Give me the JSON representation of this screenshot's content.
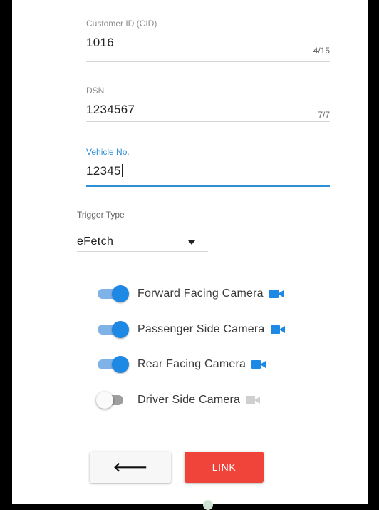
{
  "form": {
    "customer_id": {
      "label": "Customer ID (CID)",
      "value": "1016",
      "counter": "4/15"
    },
    "dsn": {
      "label": "DSN",
      "value": "1234567",
      "counter": "7/7"
    },
    "vehicle_no": {
      "label": "Vehicle No.",
      "value": "12345"
    },
    "trigger_type": {
      "label": "Trigger Type",
      "value": "eFetch"
    }
  },
  "cameras": [
    {
      "label": "Forward Facing Camera",
      "enabled": true
    },
    {
      "label": "Passenger Side Camera",
      "enabled": true
    },
    {
      "label": "Rear Facing Camera",
      "enabled": true
    },
    {
      "label": "Driver Side Camera",
      "enabled": false
    }
  ],
  "actions": {
    "back_label": "🡐",
    "link_label": "LINK"
  },
  "colors": {
    "accent": "#1e88e5",
    "focus": "#2f8fd6",
    "link_button": "#f0433a",
    "disabled_icon": "#cfcfcf"
  },
  "icons": {
    "camera": "videocam-icon",
    "back": "arrow-left-icon",
    "dropdown": "caret-down-icon"
  }
}
